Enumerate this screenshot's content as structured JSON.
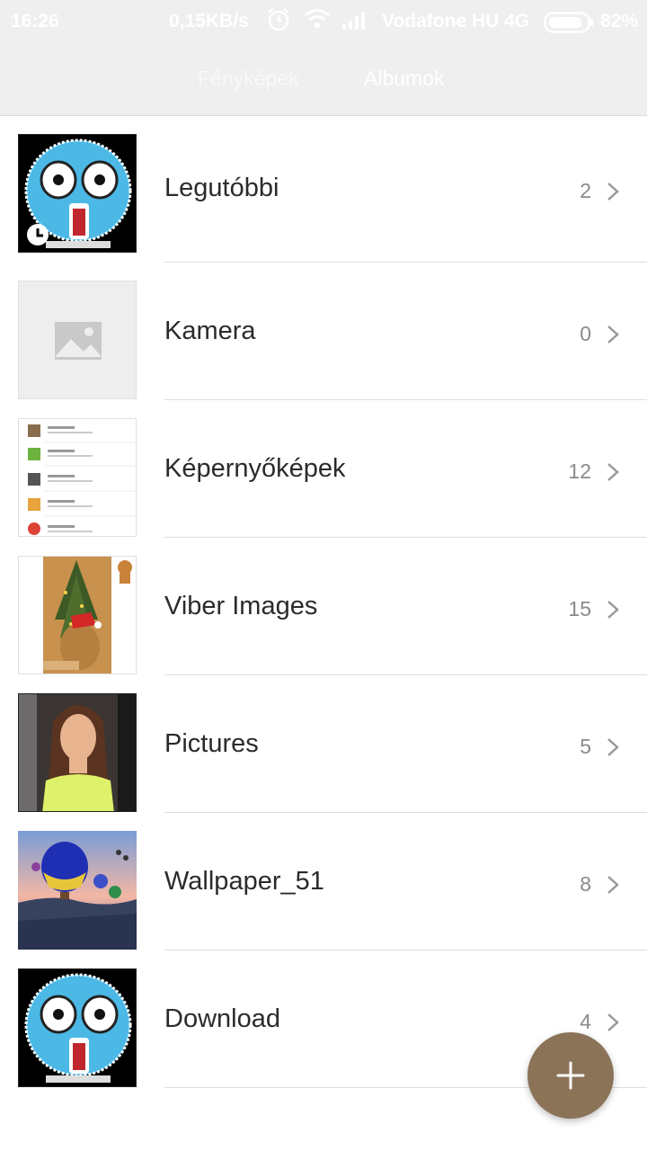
{
  "status_bar": {
    "time": "16:26",
    "speed": "0,15KB/s",
    "carrier": "Vodafone HU 4G",
    "battery": "82%"
  },
  "tabs": [
    {
      "label": "Fényképek",
      "active": false
    },
    {
      "label": "Albumok",
      "active": true
    }
  ],
  "albums": [
    {
      "name": "Legutóbbi",
      "count": "2",
      "thumb_icon": "recent-clock-icon"
    },
    {
      "name": "Kamera",
      "count": "0",
      "thumb_icon": "image-placeholder-icon"
    },
    {
      "name": "Képernyőképek",
      "count": "12",
      "thumb_icon": "screenshot-thumbnail"
    },
    {
      "name": "Viber Images",
      "count": "15",
      "thumb_icon": "viber-thumbnail"
    },
    {
      "name": "Pictures",
      "count": "5",
      "thumb_icon": "portrait-thumbnail"
    },
    {
      "name": "Wallpaper_51",
      "count": "8",
      "thumb_icon": "balloon-thumbnail"
    },
    {
      "name": "Download",
      "count": "4",
      "thumb_icon": "emoji-thumbnail"
    }
  ],
  "fab": {
    "icon": "plus-icon"
  },
  "colors": {
    "header_bg": "#efefef",
    "fab": "#8b7358",
    "divider": "#dedede",
    "title_text": "#2b2b2b",
    "count_text": "#8a8a8a"
  }
}
